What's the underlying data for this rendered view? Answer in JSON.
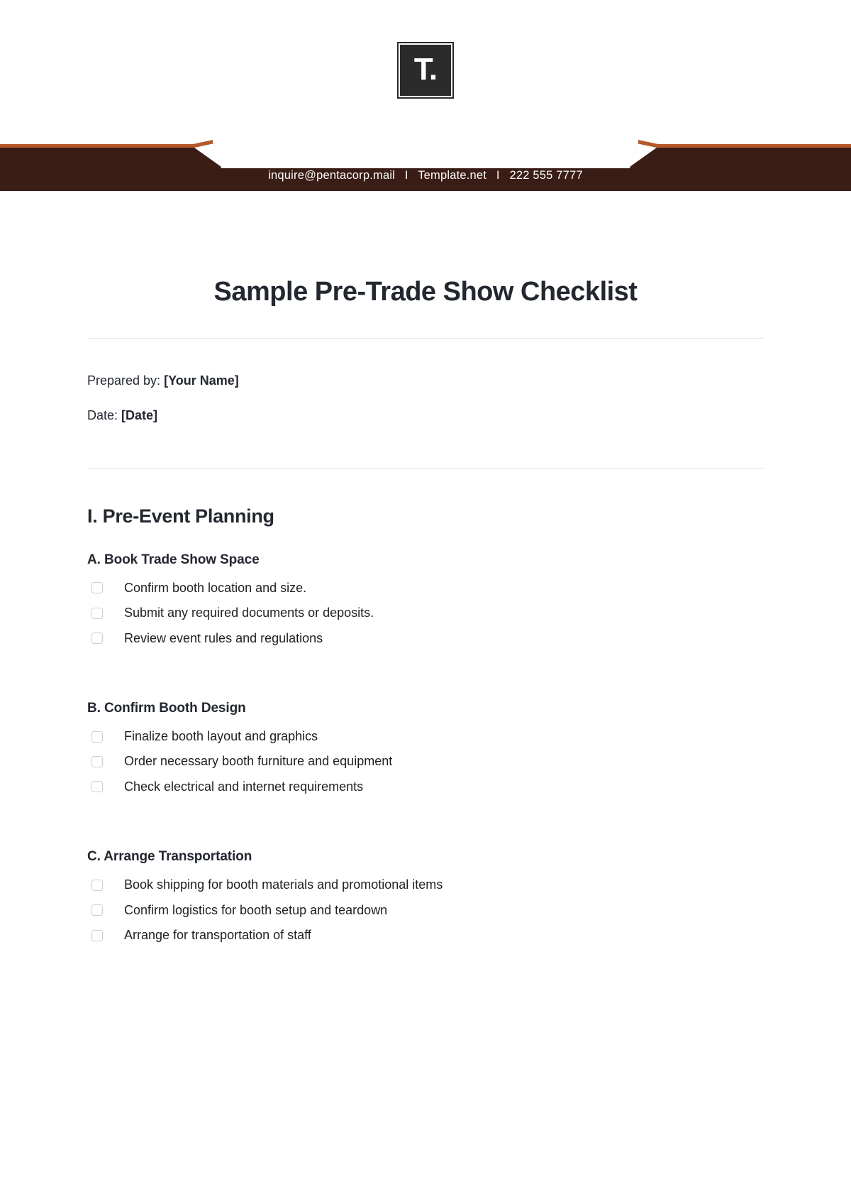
{
  "logo": {
    "mark": "T.",
    "icon": "template-t-logo"
  },
  "header": {
    "background_color": "#3a1d14",
    "accent_color": "#b5592a",
    "contact": {
      "email": "inquire@pentacorp.mail",
      "website": "Template.net",
      "phone": "222 555 7777",
      "separator": "I"
    }
  },
  "document": {
    "title": "Sample Pre-Trade Show Checklist",
    "meta": [
      {
        "label": "Prepared by:",
        "value": "[Your Name]"
      },
      {
        "label": "Date:",
        "value": "[Date]"
      }
    ],
    "sections": [
      {
        "heading": "I. Pre-Event Planning",
        "subsections": [
          {
            "heading": "A. Book Trade Show Space",
            "items": [
              {
                "label": "Confirm booth location and size.",
                "checked": false
              },
              {
                "label": "Submit any required documents or deposits.",
                "checked": false
              },
              {
                "label": "Review event rules and regulations",
                "checked": false
              }
            ]
          },
          {
            "heading": "B. Confirm Booth Design",
            "items": [
              {
                "label": "Finalize booth layout and graphics",
                "checked": false
              },
              {
                "label": "Order necessary booth furniture and equipment",
                "checked": false
              },
              {
                "label": "Check electrical and internet requirements",
                "checked": false
              }
            ]
          },
          {
            "heading": "C. Arrange Transportation",
            "items": [
              {
                "label": "Book shipping for booth materials and promotional items",
                "checked": false
              },
              {
                "label": "Confirm logistics for booth setup and teardown",
                "checked": false
              },
              {
                "label": "Arrange for transportation of staff",
                "checked": false
              }
            ]
          }
        ]
      }
    ]
  }
}
